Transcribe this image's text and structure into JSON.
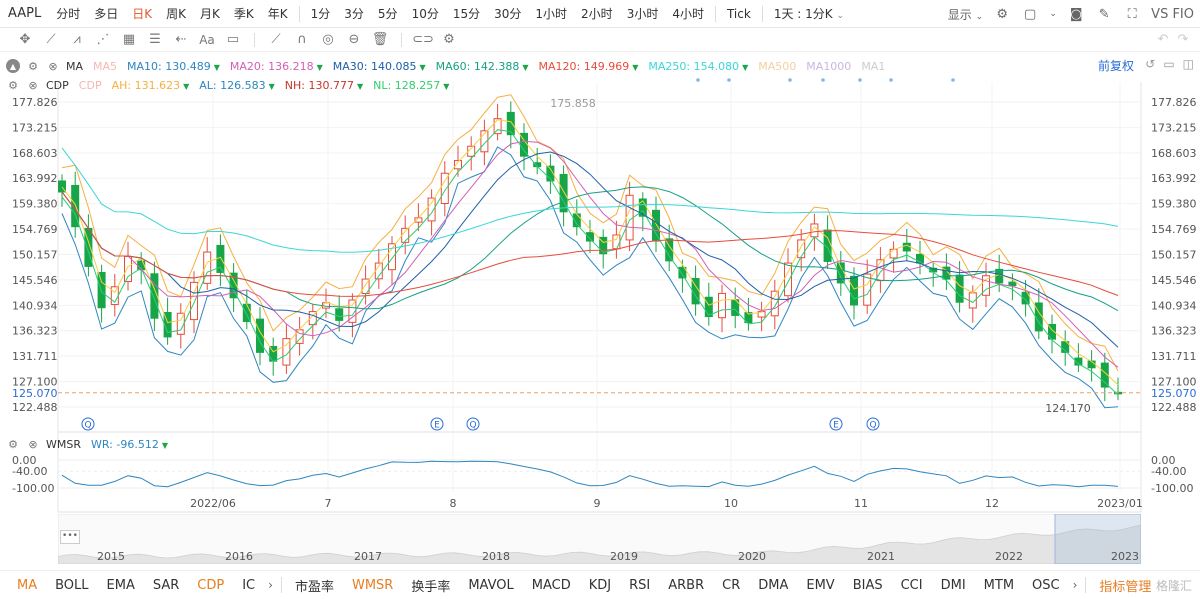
{
  "topbar": {
    "symbol": "AAPL",
    "periods": [
      {
        "label": "分时",
        "active": false
      },
      {
        "label": "多日",
        "active": false
      },
      {
        "label": "日K",
        "active": true
      },
      {
        "label": "周K",
        "active": false
      },
      {
        "label": "月K",
        "active": false
      },
      {
        "label": "季K",
        "active": false
      },
      {
        "label": "年K",
        "active": false
      },
      {
        "label": "1分",
        "active": false
      },
      {
        "label": "3分",
        "active": false
      },
      {
        "label": "5分",
        "active": false
      },
      {
        "label": "10分",
        "active": false
      },
      {
        "label": "15分",
        "active": false
      },
      {
        "label": "30分",
        "active": false
      },
      {
        "label": "1小时",
        "active": false
      },
      {
        "label": "2小时",
        "active": false
      },
      {
        "label": "3小时",
        "active": false
      },
      {
        "label": "4小时",
        "active": false
      },
      {
        "label": "Tick",
        "active": false
      }
    ],
    "custom_period": "1天 : 1分K",
    "display_label": "显示",
    "vs_label": "VS FIO"
  },
  "legend_ma": {
    "name": "MA",
    "items": [
      {
        "label": "MA5",
        "value": "",
        "color": "#f5b7b1",
        "trend": ""
      },
      {
        "label": "MA10:",
        "value": "130.489",
        "color": "#2e86c1",
        "trend": "up"
      },
      {
        "label": "MA20:",
        "value": "136.218",
        "color": "#d35fb7",
        "trend": "up"
      },
      {
        "label": "MA30:",
        "value": "140.085",
        "color": "#1f5fa8",
        "trend": "up"
      },
      {
        "label": "MA60:",
        "value": "142.388",
        "color": "#16a085",
        "trend": "up"
      },
      {
        "label": "MA120:",
        "value": "149.969",
        "color": "#e74c3c",
        "trend": "up"
      },
      {
        "label": "MA250:",
        "value": "154.080",
        "color": "#3bd6d6",
        "trend": "up"
      },
      {
        "label": "MA500",
        "value": "",
        "color": "#f3cfa3",
        "trend": ""
      },
      {
        "label": "MA1000",
        "value": "",
        "color": "#c9b7e0",
        "trend": ""
      },
      {
        "label": "MA1",
        "value": "",
        "color": "#cccccc",
        "trend": ""
      }
    ],
    "fuquan": "前复权"
  },
  "legend_cdp": {
    "name": "CDP",
    "items": [
      {
        "label": "CDP",
        "value": "",
        "color": "#f5b7b1",
        "trend": ""
      },
      {
        "label": "AH:",
        "value": "131.623",
        "color": "#f5b041",
        "trend": "up"
      },
      {
        "label": "AL:",
        "value": "126.583",
        "color": "#2e86c1",
        "trend": "up"
      },
      {
        "label": "NH:",
        "value": "130.777",
        "color": "#c0392b",
        "trend": "up"
      },
      {
        "label": "NL:",
        "value": "128.257",
        "color": "#2ecc71",
        "trend": "up"
      }
    ]
  },
  "legend_wmsr": {
    "name": "WMSR",
    "items": [
      {
        "label": "WR:",
        "value": "-96.512",
        "color": "#2e86c1",
        "trend": "up"
      }
    ]
  },
  "chart_data": {
    "type": "candlestick",
    "symbol": "AAPL",
    "period": "日K",
    "price_axis_ticks": [
      "177.826",
      "173.215",
      "168.603",
      "163.992",
      "159.380",
      "154.769",
      "150.157",
      "145.546",
      "140.934",
      "136.323",
      "131.711",
      "127.100",
      "122.488"
    ],
    "ylim": [
      122.488,
      177.826
    ],
    "current_price": "125.070",
    "high_annotation": "175.858",
    "low_annotation": "124.170",
    "date_ticks": [
      "2022/06",
      "7",
      "8",
      "9",
      "10",
      "11",
      "12",
      "2023/01"
    ],
    "event_markers": [
      "Q",
      "E",
      "Q",
      "E",
      "Q",
      "Q"
    ],
    "close_series": [
      161.5,
      155.2,
      148.0,
      140.5,
      144.3,
      149.8,
      147.4,
      138.6,
      135.2,
      139.5,
      145.1,
      150.6,
      146.9,
      142.3,
      138.0,
      132.4,
      130.8,
      134.9,
      136.5,
      139.8,
      141.4,
      138.2,
      141.9,
      145.7,
      148.6,
      152.1,
      154.9,
      156.8,
      160.4,
      164.9,
      167.2,
      169.8,
      172.6,
      174.8,
      171.9,
      168.0,
      166.1,
      163.5,
      157.9,
      155.2,
      152.6,
      150.3,
      153.7,
      160.9,
      157.1,
      152.6,
      149.0,
      145.9,
      141.2,
      138.9,
      143.1,
      139.1,
      137.8,
      139.8,
      143.5,
      148.6,
      152.8,
      155.7,
      148.9,
      145.0,
      141.0,
      146.6,
      149.2,
      151.1,
      150.8,
      148.6,
      147.0,
      145.7,
      141.5,
      143.2,
      146.3,
      145.0,
      144.5,
      141.2,
      136.3,
      134.8,
      132.4,
      130.1,
      129.6,
      126.1,
      125.1
    ],
    "wr_axis_ticks": [
      "0.00",
      "-40.00",
      "-100.00"
    ],
    "wr_value": "-96.512",
    "navigator_years": [
      "2015",
      "2016",
      "2017",
      "2018",
      "2019",
      "2020",
      "2021",
      "2022",
      "2023"
    ]
  },
  "bottom_tabs": {
    "items": [
      {
        "label": "MA",
        "active": true
      },
      {
        "label": "BOLL",
        "active": false
      },
      {
        "label": "EMA",
        "active": false
      },
      {
        "label": "SAR",
        "active": false
      },
      {
        "label": "CDP",
        "active": true
      },
      {
        "label": "IC",
        "active": false
      }
    ],
    "items2": [
      {
        "label": "市盈率",
        "active": false
      },
      {
        "label": "WMSR",
        "active": true
      },
      {
        "label": "换手率",
        "active": false
      },
      {
        "label": "MAVOL",
        "active": false
      },
      {
        "label": "MACD",
        "active": false
      },
      {
        "label": "KDJ",
        "active": false
      },
      {
        "label": "RSI",
        "active": false
      },
      {
        "label": "ARBR",
        "active": false
      },
      {
        "label": "CR",
        "active": false
      },
      {
        "label": "DMA",
        "active": false
      },
      {
        "label": "EMV",
        "active": false
      },
      {
        "label": "BIAS",
        "active": false
      },
      {
        "label": "CCI",
        "active": false
      },
      {
        "label": "DMI",
        "active": false
      },
      {
        "label": "MTM",
        "active": false
      },
      {
        "label": "OSC",
        "active": false
      }
    ],
    "manager": "指标管理",
    "watermark": "格隆汇"
  }
}
